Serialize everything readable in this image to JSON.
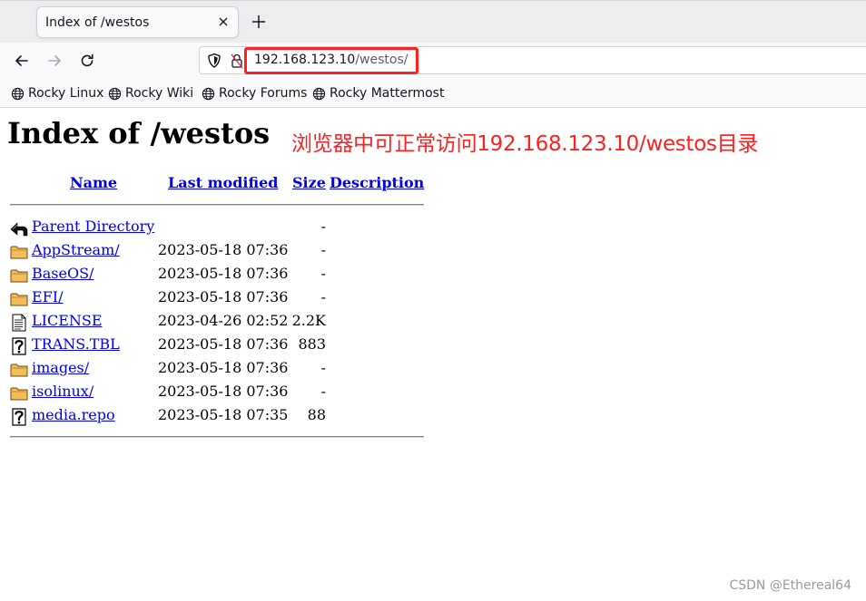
{
  "browser": {
    "tab": {
      "title": "Index of /westos"
    },
    "url": {
      "host": "192.168.123.10",
      "path": "/westos/"
    },
    "bookmarks": [
      {
        "label": "Rocky Linux",
        "icon": "globe-icon"
      },
      {
        "label": "Rocky Wiki",
        "icon": "globe-icon"
      },
      {
        "label": "Rocky Forums",
        "icon": "globe-icon"
      },
      {
        "label": "Rocky Mattermost",
        "icon": "globe-icon"
      }
    ]
  },
  "page": {
    "title": "Index of /westos",
    "annotation": "浏览器中可正常访问192.168.123.10/westos目录",
    "annotation_color": "#ff2020",
    "columns": {
      "name": "Name",
      "modified": "Last modified",
      "size": "Size",
      "description": "Description"
    },
    "rows": [
      {
        "icon": "back-arrow-icon",
        "name": "Parent Directory",
        "modified": "",
        "size": "-"
      },
      {
        "icon": "folder-icon",
        "name": "AppStream/",
        "modified": "2023-05-18 07:36",
        "size": "-"
      },
      {
        "icon": "folder-icon",
        "name": "BaseOS/",
        "modified": "2023-05-18 07:36",
        "size": "-"
      },
      {
        "icon": "folder-icon",
        "name": "EFI/",
        "modified": "2023-05-18 07:36",
        "size": "-"
      },
      {
        "icon": "text-file-icon",
        "name": "LICENSE",
        "modified": "2023-04-26 02:52",
        "size": "2.2K"
      },
      {
        "icon": "unknown-file-icon",
        "name": "TRANS.TBL",
        "modified": "2023-05-18 07:36",
        "size": "883"
      },
      {
        "icon": "folder-icon",
        "name": "images/",
        "modified": "2023-05-18 07:36",
        "size": "-"
      },
      {
        "icon": "folder-icon",
        "name": "isolinux/",
        "modified": "2023-05-18 07:36",
        "size": "-"
      },
      {
        "icon": "unknown-file-icon",
        "name": "media.repo",
        "modified": "2023-05-18 07:35",
        "size": "88"
      }
    ]
  },
  "watermark": "CSDN @Ethereal64",
  "colors": {
    "link": "#0000ee",
    "highlight": "#ff2020"
  }
}
